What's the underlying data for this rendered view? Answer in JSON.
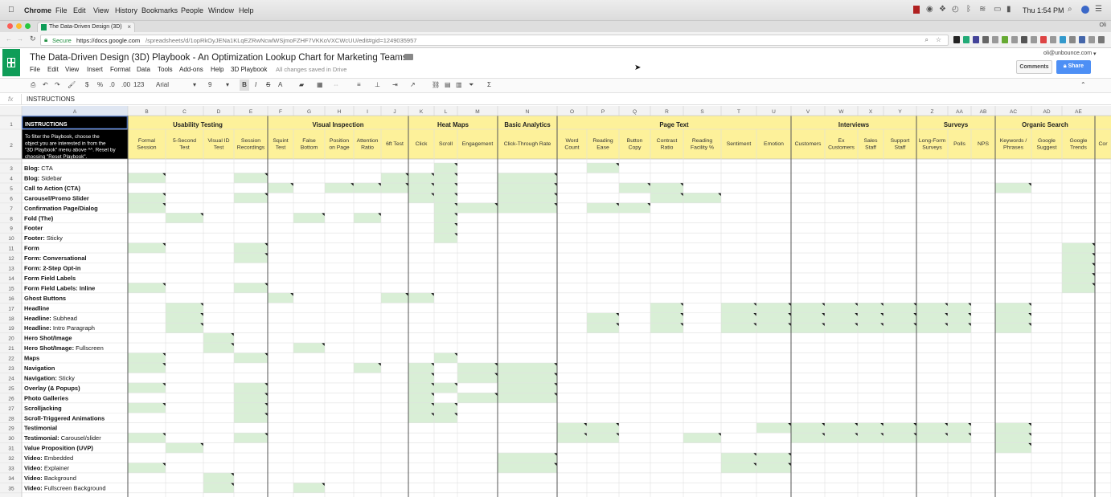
{
  "macmenu": {
    "apple": "",
    "items": [
      "Chrome",
      "File",
      "Edit",
      "View",
      "History",
      "Bookmarks",
      "People",
      "Window",
      "Help"
    ],
    "clock": "Thu 1:54 PM"
  },
  "browser": {
    "tab_title": "The Data-Driven Design (3D)",
    "profile": "Oli",
    "secure_label": "Secure",
    "url_host": "https://docs.google.com",
    "url_path": "/spreadsheets/d/1opRkOyJENa1KLqEZRwNcwlWSjmoFZHF7VKKoVXCWcUU/edit#gid=1249035957"
  },
  "sheets": {
    "doc_title": "The Data-Driven Design (3D) Playbook - An Optimization Lookup Chart for Marketing Teams",
    "menus": [
      "File",
      "Edit",
      "View",
      "Insert",
      "Format",
      "Data",
      "Tools",
      "Add-ons",
      "Help",
      "3D Playbook"
    ],
    "save_status": "All changes saved in Drive",
    "user_email": "oli@unbounce.com",
    "comments_label": "Comments",
    "share_label": "Share",
    "toolbar": {
      "dollar": "$",
      "percent": "%",
      "dec0": ".0",
      "dec00": ".00",
      "fmt123": "123",
      "font": "Arial",
      "size": "9",
      "bold": "B",
      "italic": "I",
      "strike": "S",
      "textcolor": "A",
      "sigma": "Σ"
    },
    "fx": "fx",
    "formula_value": "INSTRUCTIONS",
    "colors": {
      "accent_green": "#0f9d58",
      "header_yellow": "#fdf19a",
      "cell_green": "#d9efd6",
      "share_blue": "#4d8ff5"
    }
  },
  "grid": {
    "col_letters": [
      "A",
      "B",
      "C",
      "D",
      "E",
      "F",
      "G",
      "H",
      "I",
      "J",
      "K",
      "L",
      "M",
      "N",
      "O",
      "P",
      "Q",
      "R",
      "S",
      "T",
      "U",
      "V",
      "W",
      "X",
      "Y",
      "Z",
      "AA",
      "AB",
      "AC",
      "AD",
      "AE"
    ],
    "row1_a": "INSTRUCTIONS",
    "row2_a": "To filter the Playbook, choose the object you are interested in from the \"3D Playbook\" menu above ^^. Reset by choosing \"Reset Playbook\".",
    "groups": [
      {
        "label": "Usability Testing",
        "from": 1,
        "to": 4
      },
      {
        "label": "Visual Inspection",
        "from": 5,
        "to": 9
      },
      {
        "label": "Heat Maps",
        "from": 10,
        "to": 12
      },
      {
        "label": "Basic Analytics",
        "from": 13,
        "to": 13
      },
      {
        "label": "Page Text",
        "from": 14,
        "to": 20
      },
      {
        "label": "Interviews",
        "from": 21,
        "to": 24
      },
      {
        "label": "Surveys",
        "from": 25,
        "to": 27
      },
      {
        "label": "Organic Search",
        "from": 28,
        "to": 30
      }
    ],
    "subheaders": [
      "Formal\nSession",
      "5-Second\nTest",
      "Visual ID\nTest",
      "Session\nRecordings",
      "Squint\nTest",
      "False\nBottom",
      "Position\non Page",
      "Attention\nRatio",
      "6ft Test",
      "Click",
      "Scroll",
      "Engagement",
      "Click-Through Rate",
      "Word\nCount",
      "Reading\nEase",
      "Button\nCopy",
      "Contrast\nRatio",
      "Reading\nFacility %",
      "Sentiment",
      "Emotion",
      "Customers",
      "Ex\nCustomers",
      "Sales\nStaff",
      "Support\nStaff",
      "Long-Form\nSurveys",
      "Polls",
      "NPS",
      "Keywords /\nPhrases",
      "Google\nSuggest",
      "Google\nTrends",
      "Cor"
    ],
    "rows": [
      {
        "n": "3",
        "b": "Blog:",
        "r": " CTA"
      },
      {
        "n": "4",
        "b": "Blog:",
        "r": " Sidebar"
      },
      {
        "n": "5",
        "b": "Call to Action (CTA)",
        "r": ""
      },
      {
        "n": "6",
        "b": "Carousel/Promo Slider",
        "r": ""
      },
      {
        "n": "7",
        "b": "Confirmation Page/Dialog",
        "r": ""
      },
      {
        "n": "8",
        "b": "Fold (The)",
        "r": ""
      },
      {
        "n": "9",
        "b": "Footer",
        "r": ""
      },
      {
        "n": "10",
        "b": "Footer:",
        "r": " Sticky"
      },
      {
        "n": "11",
        "b": "Form",
        "r": ""
      },
      {
        "n": "12",
        "b": "Form: Conversational",
        "r": ""
      },
      {
        "n": "13",
        "b": "Form: 2-Step Opt-in",
        "r": ""
      },
      {
        "n": "14",
        "b": "Form Field Labels",
        "r": ""
      },
      {
        "n": "15",
        "b": "Form Field Labels: Inline",
        "r": ""
      },
      {
        "n": "16",
        "b": "Ghost Buttons",
        "r": ""
      },
      {
        "n": "17",
        "b": "Headline",
        "r": ""
      },
      {
        "n": "18",
        "b": "Headline:",
        "r": " Subhead"
      },
      {
        "n": "19",
        "b": "Headline:",
        "r": " Intro Paragraph"
      },
      {
        "n": "20",
        "b": "Hero Shot/Image",
        "r": ""
      },
      {
        "n": "21",
        "b": "Hero Shot/Image:",
        "r": " Fullscreen"
      },
      {
        "n": "22",
        "b": "Maps",
        "r": ""
      },
      {
        "n": "23",
        "b": "Navigation",
        "r": ""
      },
      {
        "n": "24",
        "b": "Navigation:",
        "r": " Sticky"
      },
      {
        "n": "25",
        "b": "Overlay (& Popups)",
        "r": ""
      },
      {
        "n": "26",
        "b": "Photo Galleries",
        "r": ""
      },
      {
        "n": "27",
        "b": "Scrolljacking",
        "r": ""
      },
      {
        "n": "28",
        "b": "Scroll-Triggered Animations",
        "r": ""
      },
      {
        "n": "29",
        "b": "Testimonial",
        "r": ""
      },
      {
        "n": "30",
        "b": "Testimonial:",
        "r": " Carousel/slider"
      },
      {
        "n": "31",
        "b": "Value Proposition (UVP)",
        "r": ""
      },
      {
        "n": "32",
        "b": "Video:",
        "r": " Embedded"
      },
      {
        "n": "33",
        "b": "Video:",
        "r": " Explainer"
      },
      {
        "n": "34",
        "b": "Video:",
        "r": " Background"
      },
      {
        "n": "35",
        "b": "Video:",
        "r": " Fullscreen Background"
      }
    ],
    "fills": [
      [
        11,
        15
      ],
      [
        1,
        4,
        9,
        10,
        11,
        13
      ],
      [
        5,
        7,
        8,
        9,
        10,
        11,
        13,
        16,
        17,
        28
      ],
      [
        1,
        4,
        10,
        11,
        13,
        17,
        18
      ],
      [
        1,
        11,
        12,
        13,
        15,
        16
      ],
      [
        2,
        6,
        8,
        11
      ],
      [
        11
      ],
      [
        11
      ],
      [
        1,
        4,
        30
      ],
      [
        4,
        30
      ],
      [
        30
      ],
      [
        30
      ],
      [
        1,
        4,
        30
      ],
      [
        5,
        9,
        10
      ],
      [
        2,
        17,
        19,
        20,
        21,
        22,
        23,
        24,
        25,
        26,
        28
      ],
      [
        2,
        15,
        17,
        19,
        20,
        21,
        22,
        23,
        24,
        25,
        26,
        28
      ],
      [
        2,
        15,
        17,
        19,
        20,
        21,
        22,
        23,
        24,
        25,
        26,
        28
      ],
      [
        3
      ],
      [
        3,
        6
      ],
      [
        1,
        4,
        11
      ],
      [
        1,
        8,
        10,
        12,
        13
      ],
      [
        10,
        12,
        13
      ],
      [
        1,
        4,
        10,
        11,
        13
      ],
      [
        4,
        10,
        12,
        13
      ],
      [
        1,
        4,
        10,
        11
      ],
      [
        4,
        10,
        11
      ],
      [
        14,
        15,
        20,
        21,
        22,
        23,
        24,
        25,
        26,
        28
      ],
      [
        1,
        4,
        14,
        15,
        18,
        21,
        22,
        23,
        24,
        25,
        26,
        28
      ],
      [
        2,
        28
      ],
      [
        13,
        19,
        20
      ],
      [
        1,
        13,
        19,
        20
      ],
      [
        3
      ],
      [
        3,
        6
      ]
    ]
  }
}
